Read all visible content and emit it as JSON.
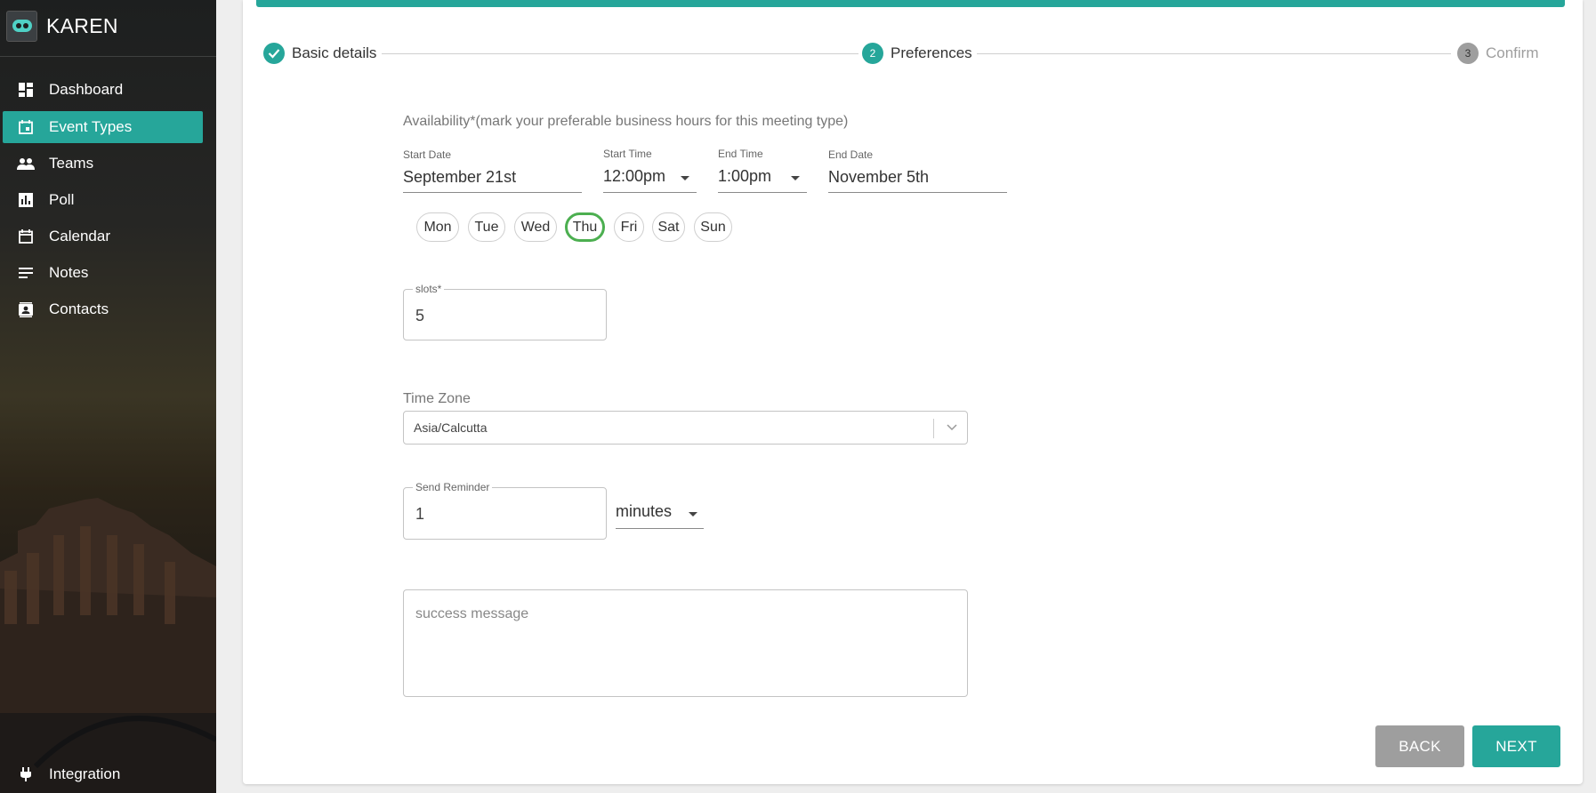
{
  "app": {
    "name": "KAREN"
  },
  "sidebar": {
    "items": [
      {
        "label": "Dashboard",
        "icon": "dashboard-icon",
        "active": false
      },
      {
        "label": "Event Types",
        "icon": "event-icon",
        "active": true
      },
      {
        "label": "Teams",
        "icon": "people-icon",
        "active": false
      },
      {
        "label": "Poll",
        "icon": "poll-icon",
        "active": false
      },
      {
        "label": "Calendar",
        "icon": "calendar-icon",
        "active": false
      },
      {
        "label": "Notes",
        "icon": "notes-icon",
        "active": false
      },
      {
        "label": "Contacts",
        "icon": "contacts-icon",
        "active": false
      }
    ],
    "footer_item": {
      "label": "Integration",
      "icon": "plug-icon"
    }
  },
  "stepper": {
    "steps": [
      {
        "label": "Basic details",
        "status": "completed",
        "marker": "check-icon"
      },
      {
        "label": "Preferences",
        "status": "active",
        "marker": "2"
      },
      {
        "label": "Confirm",
        "status": "pending",
        "marker": "3"
      }
    ]
  },
  "availability": {
    "heading": "Availability*(mark your preferable business hours for this meeting type)",
    "start_date": {
      "label": "Start Date",
      "value": "September 21st"
    },
    "start_time": {
      "label": "Start Time",
      "value": "12:00pm"
    },
    "end_time": {
      "label": "End Time",
      "value": "1:00pm"
    },
    "end_date": {
      "label": "End Date",
      "value": "November 5th"
    },
    "days": [
      {
        "label": "Mon",
        "selected": false
      },
      {
        "label": "Tue",
        "selected": false
      },
      {
        "label": "Wed",
        "selected": false
      },
      {
        "label": "Thu",
        "selected": true
      },
      {
        "label": "Fri",
        "selected": false
      },
      {
        "label": "Sat",
        "selected": false
      },
      {
        "label": "Sun",
        "selected": false
      }
    ]
  },
  "slots": {
    "label": "slots*",
    "value": "5"
  },
  "timezone": {
    "label": "Time Zone",
    "value": "Asia/Calcutta"
  },
  "reminder": {
    "label": "Send Reminder",
    "value": "1",
    "unit": "minutes"
  },
  "success_message": {
    "placeholder": "success message"
  },
  "actions": {
    "back": "BACK",
    "next": "NEXT"
  },
  "colors": {
    "accent": "#26a69a",
    "selected_day_border": "#4caf50",
    "back_button": "#9e9e9e"
  }
}
